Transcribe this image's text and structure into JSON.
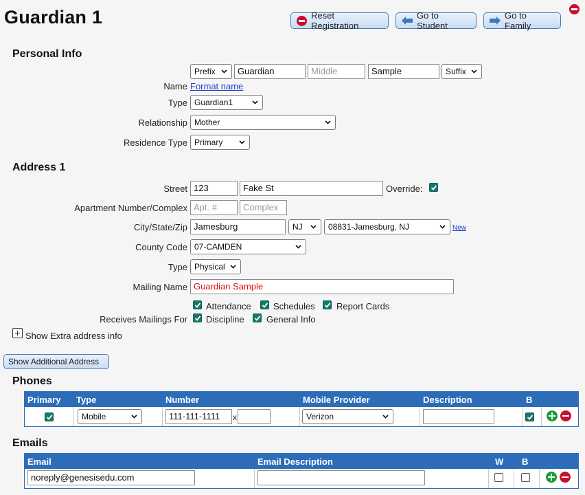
{
  "page": {
    "title": "Guardian 1",
    "reset_label": "Reset Registration",
    "student_label": "Go to Student",
    "family_label": "Go to Family"
  },
  "personal": {
    "heading": "Personal Info",
    "name_label": "Name",
    "prefix": "Prefix",
    "first": "Guardian",
    "middle_placeholder": "Middle",
    "last": "Sample",
    "suffix": "Suffix",
    "format_link": "Format name",
    "type_label": "Type",
    "type_value": "Guardian1",
    "relationship_label": "Relationship",
    "relationship_value": "Mother",
    "residence_label": "Residence Type",
    "residence_value": "Primary"
  },
  "address": {
    "heading": "Address 1",
    "street_label": "Street",
    "street_number": "123",
    "street_name": "Fake St",
    "override_label": "Override:",
    "apt_label": "Apartment Number/Complex",
    "apt_placeholder": "Apt. #",
    "complex_placeholder": "Complex",
    "city_label": "City/State/Zip",
    "city": "Jamesburg",
    "state": "NJ",
    "zip": "08831-Jamesburg, NJ",
    "new_link": "New",
    "county_label": "County Code",
    "county": "07-CAMDEN",
    "type_label": "Type",
    "type_value": "Physical",
    "mailing_label": "Mailing Name",
    "mailing_value": "Guardian Sample",
    "receives_label": "Receives Mailings For",
    "mailings": [
      "Attendance",
      "Schedules",
      "Report Cards",
      "Discipline",
      "General Info"
    ],
    "extra_label": "Show Extra address info",
    "additional_button": "Show Additional Address"
  },
  "phones": {
    "heading": "Phones",
    "columns": [
      "Primary",
      "Type",
      "Number",
      "Mobile Provider",
      "Description",
      "B"
    ],
    "rows": [
      {
        "type": "Mobile",
        "number": "111-111-1111",
        "ext_sep": "x",
        "provider": "Verizon",
        "description": ""
      }
    ]
  },
  "emails": {
    "heading": "Emails",
    "columns": [
      "Email",
      "Email Description",
      "W",
      "B"
    ],
    "rows": [
      {
        "email": "noreply@genesisedu.com",
        "description": ""
      }
    ]
  },
  "colors": {
    "accent": "#2d6db8",
    "check": "#15786b",
    "danger": "#c8102e",
    "add": "#1e9a3a"
  }
}
